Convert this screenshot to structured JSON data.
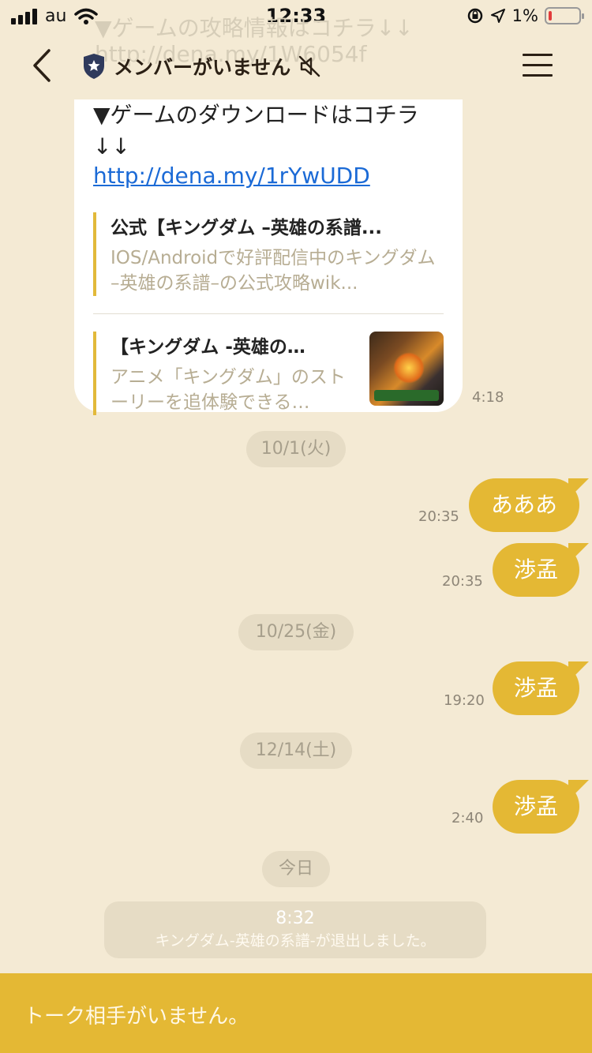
{
  "status_bar": {
    "carrier": "au",
    "time": "12:33",
    "battery": "1%",
    "battery_level": 0.01
  },
  "ghost": {
    "line1": "▼ゲームの攻略情報はコチラ↓↓",
    "line2": "http://dena.my/1W6054f"
  },
  "header": {
    "title": "メンバーがいません",
    "icons": [
      "back-chevron-icon",
      "shield-star-icon",
      "mute-speaker-icon",
      "hamburger-menu-icon"
    ]
  },
  "received": {
    "text": "▼ゲームのダウンロードはコチラ↓↓",
    "link": "http://dena.my/1rYwUDD",
    "time": "4:18",
    "card1": {
      "title": "公式【キングダム –英雄の系譜...",
      "desc": "IOS/Androidで好評配信中のキングダム –英雄の系譜–の公式攻略wik..."
    },
    "card2": {
      "title": "【キングダム -英雄の…",
      "desc": "アニメ「キングダム」のストーリーを追体験できる…"
    }
  },
  "timeline": {
    "date1": "10/1(火)",
    "msg1": "あああ",
    "msg1_time": "20:35",
    "msg2": "渉孟",
    "msg2_time": "20:35",
    "date2": "10/25(金)",
    "msg3": "渉孟",
    "msg3_time": "19:20",
    "date3": "12/14(土)",
    "msg4": "渉孟",
    "msg4_time": "2:40",
    "date4": "今日",
    "system_time": "8:32",
    "system_msg": "キングダム-英雄の系譜-が退出しました。"
  },
  "bottom": {
    "text": "トーク相手がいません。"
  },
  "colors": {
    "background": "#f4ead4",
    "accent": "#e4b834",
    "link": "#1b6ad6"
  }
}
